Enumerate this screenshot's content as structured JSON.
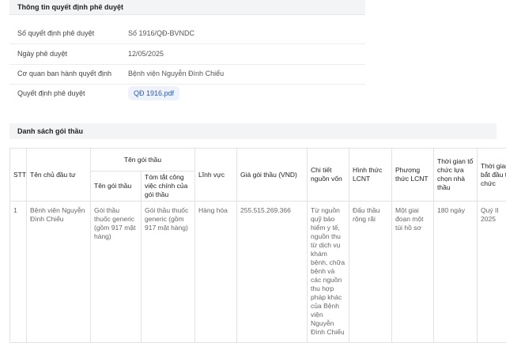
{
  "approval": {
    "header": "Thông tin quyết định phê duyệt",
    "rows": [
      {
        "label": "Số quyết định phê duyệt",
        "value": "Số 1916/QĐ-BVNDC"
      },
      {
        "label": "Ngày phê duyệt",
        "value": "12/05/2025"
      },
      {
        "label": "Cơ quan ban hành quyết định",
        "value": "Bệnh viện Nguyễn Đình Chiểu"
      },
      {
        "label": "Quyết định phê duyệt",
        "value": "QĐ 1916.pdf"
      }
    ]
  },
  "packages": {
    "header": "Danh sách gói thầu",
    "columns": {
      "stt": "STT",
      "investor": "Tên chủ đầu tư",
      "group": "Tên gói thầu",
      "name": "Tên gói thầu",
      "summary": "Tóm tắt công việc chính của gói thầu",
      "field": "Lĩnh vực",
      "price": "Giá gói thầu (VND)",
      "source": "Chi tiết nguồn vốn",
      "form": "Hình thức LCNT",
      "method": "Phương thức LCNT",
      "duration": "Thời gian tổ chức lựa chọn nhà thầu",
      "start": "Thời gian bắt đầu tổ chức"
    },
    "rows": [
      {
        "stt": "1",
        "investor": "Bệnh viện Nguyễn Đình Chiểu",
        "name": "Gói thầu thuốc generic (gồm 917 mặt hàng)",
        "summary": "Gói thầu thuốc generic (gồm 917 mặt hàng)",
        "field": "Hàng hóa",
        "price": "255.515.269.366",
        "source": "Từ nguồn quỹ bảo hiểm y tế, nguồn thu từ dịch vụ khám bệnh, chữa bệnh và các nguồn thu hợp pháp khác của Bệnh viện Nguyễn Đình Chiểu",
        "form": "Đấu thầu rộng rãi",
        "method": "Một giai đoạn một túi hồ sơ",
        "duration": "180 ngày",
        "start": "Quý II 2025"
      }
    ]
  }
}
